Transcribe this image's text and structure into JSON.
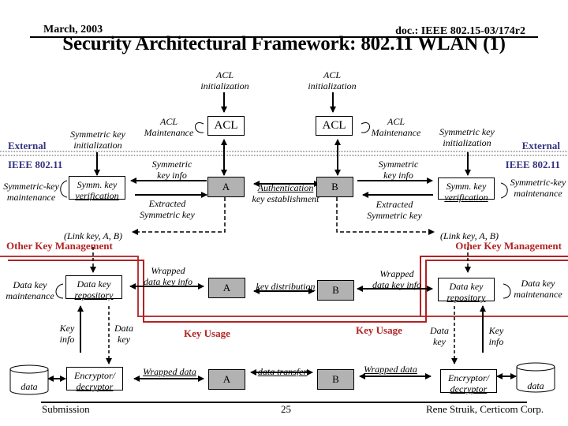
{
  "header": {
    "date": "March, 2003",
    "doc_id": "doc.: IEEE 802.15-03/174r2",
    "title": "Security Architectural Framework: 802.11 WLAN (1)"
  },
  "layers": {
    "external": "External",
    "ieee": "IEEE 802.11",
    "other_key_management": "Other Key Management",
    "key_usage": "Key Usage"
  },
  "left": {
    "acl_init": [
      "ACL",
      "initialization"
    ],
    "acl_maintenance": [
      "ACL",
      "Maintenance"
    ],
    "acl_box": "ACL",
    "sym_key_init": [
      "Symmetric key",
      "initialization"
    ],
    "sym_key_maintenance": [
      "Symmetric-key",
      "maintenance"
    ],
    "symm_key_verification": [
      "Symm. key",
      "verification"
    ],
    "symmetric_key_info": [
      "Symmetric",
      "key info"
    ],
    "extracted_symmetric_key": [
      "Extracted",
      "Symmetric key"
    ],
    "link_key": "(Link key, A, B)",
    "data_key_maintenance": [
      "Data key",
      "maintenance"
    ],
    "data_key_repository": [
      "Data key",
      "repository"
    ],
    "wrapped_data_key_info": [
      "Wrapped",
      "data key info"
    ],
    "key_info": [
      "Key",
      "info"
    ],
    "data_key": [
      "Data",
      "key"
    ],
    "data_store": "data",
    "encryptor": [
      "Encryptor/",
      "decryptor"
    ],
    "wrapped_data": "Wrapped data"
  },
  "right": {
    "acl_init": [
      "ACL",
      "initialization"
    ],
    "acl_maintenance": [
      "ACL",
      "Maintenance"
    ],
    "acl_box": "ACL",
    "sym_key_init": [
      "Symmetric key",
      "initialization"
    ],
    "sym_key_maintenance": [
      "Symmetric-key",
      "maintenance"
    ],
    "symm_key_verification": [
      "Symm. key",
      "verification"
    ],
    "symmetric_key_info": [
      "Symmetric",
      "key info"
    ],
    "extracted_symmetric_key": [
      "Extracted",
      "Symmetric key"
    ],
    "link_key": "(Link key, A, B)",
    "data_key_maintenance": [
      "Data key",
      "maintenance"
    ],
    "data_key_repository": [
      "Data key",
      "repository"
    ],
    "wrapped_data_key_info": [
      "Wrapped",
      "data key info"
    ],
    "key_info": [
      "Key",
      "info"
    ],
    "data_key": [
      "Data",
      "key"
    ],
    "data_store": "data",
    "encryptor": [
      "Encryptor/",
      "decryptor"
    ],
    "wrapped_data": "Wrapped data"
  },
  "center": {
    "party_a": "A",
    "party_b": "B",
    "auth_key_establishment": [
      "Authentication",
      "key establishment"
    ],
    "key_distribution": "key distribution",
    "data_transfer": "data transfer"
  },
  "footer": {
    "left": "Submission",
    "page": "25",
    "right": "Rene Struik, Certicom Corp."
  },
  "colors": {
    "layer_blue": "#333380",
    "layer_red": "#b22222",
    "party_fill": "#b2b2b2"
  }
}
